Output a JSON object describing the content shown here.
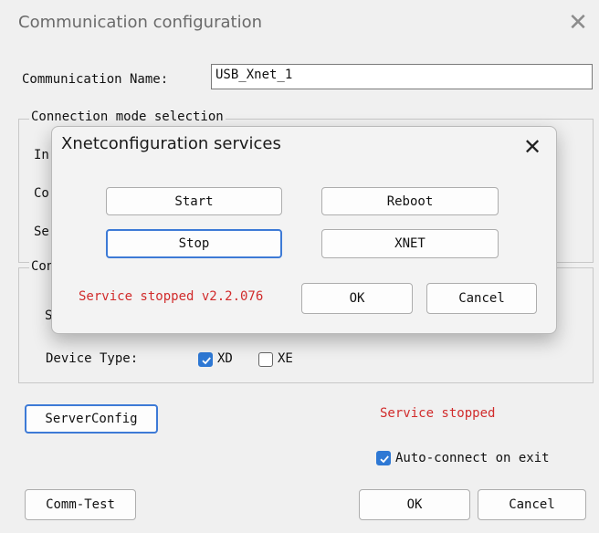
{
  "window": {
    "title": "Communication configuration",
    "close_glyph": "✕"
  },
  "form": {
    "name_label": "Communication Name:",
    "name_value": "USB_Xnet_1",
    "connection_group_label": "Connection mode selection",
    "partial_labels": [
      "In",
      "Co",
      "Se"
    ],
    "group2_label_partial": "Con",
    "group2_row1_partial": "S",
    "device_type_label": "Device Type:",
    "device_xd_label": "XD",
    "device_xd_checked": true,
    "device_xe_label": "XE",
    "device_xe_checked": false
  },
  "bottom": {
    "server_config_label": "ServerConfig",
    "status_text": "Service stopped",
    "auto_connect_label": "Auto-connect on exit",
    "auto_connect_checked": true,
    "comm_test_label": "Comm-Test",
    "ok_label": "OK",
    "cancel_label": "Cancel"
  },
  "popup": {
    "title": "Xnetconfiguration services",
    "close_glyph": "✕",
    "start_label": "Start",
    "reboot_label": "Reboot",
    "stop_label": "Stop",
    "xnet_label": "XNET",
    "status_text": "Service stopped v2.2.076",
    "ok_label": "OK",
    "cancel_label": "Cancel"
  },
  "colors": {
    "accent": "#2e78d4",
    "error_text": "#d12c2c",
    "background": "#f0f0f0"
  },
  "icons": {
    "close": "close-icon",
    "checkmark": "checkmark-icon"
  }
}
